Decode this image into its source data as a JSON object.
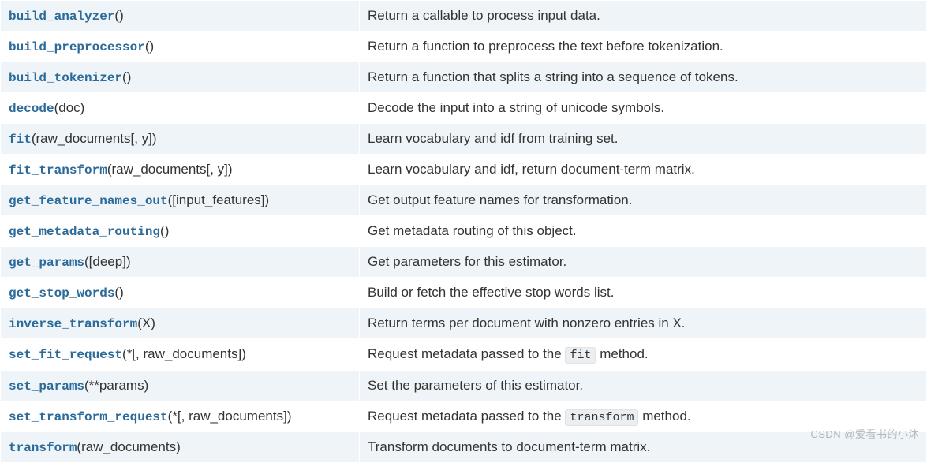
{
  "methods": [
    {
      "name": "build_analyzer",
      "args": "()",
      "desc": "Return a callable to process input data."
    },
    {
      "name": "build_preprocessor",
      "args": "()",
      "desc": "Return a function to preprocess the text before tokenization."
    },
    {
      "name": "build_tokenizer",
      "args": "()",
      "desc": "Return a function that splits a string into a sequence of tokens."
    },
    {
      "name": "decode",
      "args": "(doc)",
      "desc": "Decode the input into a string of unicode symbols."
    },
    {
      "name": "fit",
      "args": "(raw_documents[, y])",
      "desc": "Learn vocabulary and idf from training set."
    },
    {
      "name": "fit_transform",
      "args": "(raw_documents[, y])",
      "desc": "Learn vocabulary and idf, return document-term matrix."
    },
    {
      "name": "get_feature_names_out",
      "args": "([input_features])",
      "desc": "Get output feature names for transformation."
    },
    {
      "name": "get_metadata_routing",
      "args": "()",
      "desc": "Get metadata routing of this object."
    },
    {
      "name": "get_params",
      "args": "([deep])",
      "desc": "Get parameters for this estimator."
    },
    {
      "name": "get_stop_words",
      "args": "()",
      "desc": "Build or fetch the effective stop words list."
    },
    {
      "name": "inverse_transform",
      "args": "(X)",
      "desc": "Return terms per document with nonzero entries in X."
    },
    {
      "name": "set_fit_request",
      "args": "(*[, raw_documents])",
      "desc_parts": [
        "Request metadata passed to the ",
        {
          "code": "fit"
        },
        " method."
      ]
    },
    {
      "name": "set_params",
      "args": "(**params)",
      "desc": "Set the parameters of this estimator."
    },
    {
      "name": "set_transform_request",
      "args": "(*[, raw_documents])",
      "desc_parts": [
        "Request metadata passed to the ",
        {
          "code": "transform"
        },
        " method."
      ]
    },
    {
      "name": "transform",
      "args": "(raw_documents)",
      "desc": "Transform documents to document-term matrix."
    }
  ],
  "watermark": "CSDN @爱看书的小沐"
}
